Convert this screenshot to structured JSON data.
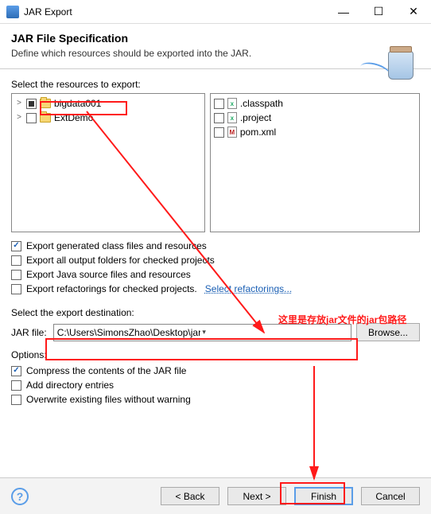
{
  "window": {
    "title": "JAR Export"
  },
  "header": {
    "title": "JAR File Specification",
    "subtitle": "Define which resources should be exported into the JAR."
  },
  "selectResources": {
    "label": "Select the resources to export:",
    "tree": [
      {
        "expander": ">",
        "check": "square",
        "name": "bigdata001"
      },
      {
        "expander": ">",
        "check": "empty",
        "name": "ExtDemo"
      }
    ],
    "files": [
      {
        "check": "empty",
        "icon": "x",
        "name": ".classpath"
      },
      {
        "check": "empty",
        "icon": "x",
        "name": ".project"
      },
      {
        "check": "empty",
        "icon": "m",
        "name": "pom.xml"
      }
    ]
  },
  "exportOptions": [
    {
      "checked": true,
      "label": "Export generated class files and resources"
    },
    {
      "checked": false,
      "label": "Export all output folders for checked projects"
    },
    {
      "checked": false,
      "label": "Export Java source files and resources"
    },
    {
      "checked": false,
      "label": "Export refactorings for checked projects.",
      "trailingLink": "Select refactorings..."
    }
  ],
  "destination": {
    "sectionLabel": "Select the export destination:",
    "fieldLabel": "JAR file:",
    "value": "C:\\Users\\SimonsZhao\\Desktop\\jar\\JarDemo.jar",
    "browse": "Browse..."
  },
  "optionsSection": {
    "label": "Options:",
    "rows": [
      {
        "checked": true,
        "label": "Compress the contents of the JAR file"
      },
      {
        "checked": false,
        "label": "Add directory entries"
      },
      {
        "checked": false,
        "label": "Overwrite existing files without warning"
      }
    ]
  },
  "buttons": {
    "back": "< Back",
    "next": "Next >",
    "finish": "Finish",
    "cancel": "Cancel"
  },
  "annotation": {
    "text": "这里是存放jar文件的jar包路径"
  }
}
